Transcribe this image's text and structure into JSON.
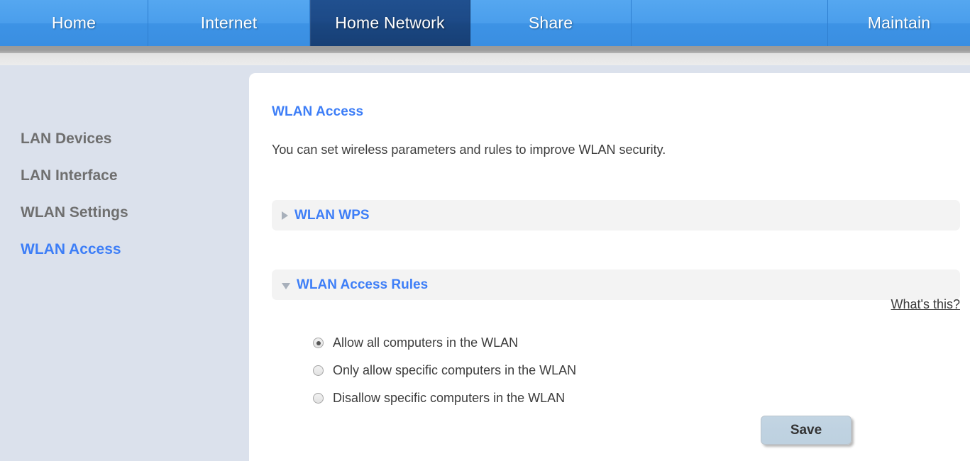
{
  "nav": {
    "tabs": [
      {
        "label": "Home",
        "active": false
      },
      {
        "label": "Internet",
        "active": false
      },
      {
        "label": "Home Network",
        "active": true
      },
      {
        "label": "Share",
        "active": false
      },
      {
        "label": "",
        "active": false
      },
      {
        "label": "Maintain",
        "active": false
      }
    ],
    "active_tab": "Home Network"
  },
  "sidebar": {
    "items": [
      {
        "label": "LAN Devices",
        "active": false
      },
      {
        "label": "LAN Interface",
        "active": false
      },
      {
        "label": "WLAN Settings",
        "active": false
      },
      {
        "label": "WLAN Access",
        "active": true
      }
    ]
  },
  "main": {
    "title": "WLAN Access",
    "description": "You can set wireless parameters and rules to improve WLAN security.",
    "sections": [
      {
        "label": "WLAN WPS",
        "expanded": false,
        "icon": "triangle-right-icon"
      },
      {
        "label": "WLAN Access Rules",
        "expanded": true,
        "icon": "triangle-down-icon"
      }
    ],
    "help_link": "What's this?",
    "access_rules": {
      "options": [
        {
          "label": "Allow all computers in the WLAN",
          "selected": true
        },
        {
          "label": "Only allow specific computers in the WLAN",
          "selected": false
        },
        {
          "label": "Disallow specific computers in the WLAN",
          "selected": false
        }
      ],
      "selected_value": "Allow all computers in the WLAN"
    },
    "save_label": "Save"
  },
  "colors": {
    "nav_blue": "#4a9eec",
    "nav_active_navy": "#1d4a87",
    "link_blue": "#3d7ef7",
    "sidebar_bg": "#dbe1ec",
    "section_bar_bg": "#f3f3f3",
    "save_button_bg": "#bfd2e1",
    "text_gray": "#6f6f6f",
    "body_text": "#3c3c3c"
  }
}
